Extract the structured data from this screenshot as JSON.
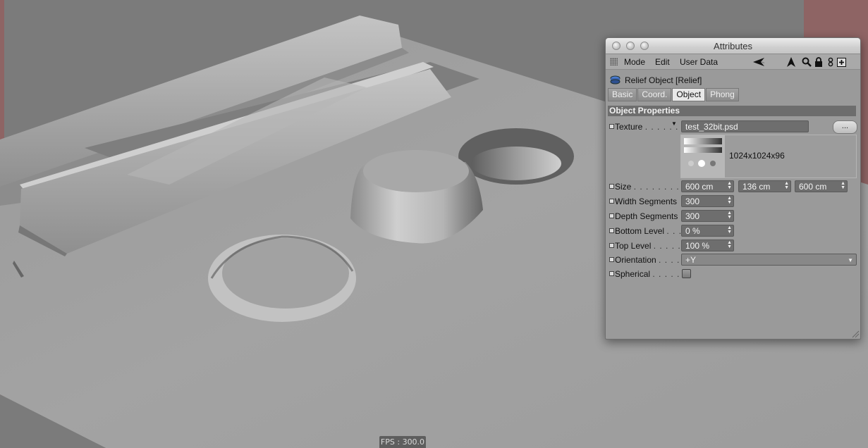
{
  "viewport": {
    "fps": "FPS : 300.0"
  },
  "window": {
    "title": "Attributes",
    "menu": [
      "Mode",
      "Edit",
      "User Data"
    ],
    "toolbar_icons": [
      "back-arrow-icon",
      "cursor-arrow-icon",
      "search-icon",
      "lock-icon",
      "link-icon",
      "new-window-icon"
    ],
    "object_label": "Relief Object [Relief]",
    "tabs": [
      {
        "label": "Basic",
        "active": false
      },
      {
        "label": "Coord.",
        "active": false
      },
      {
        "label": "Object",
        "active": true
      },
      {
        "label": "Phong",
        "active": false
      }
    ],
    "section_title": "Object Properties",
    "texture": {
      "label": "Texture",
      "dots": ". . . . . .",
      "value": "test_32bit.psd",
      "browse_label": "...",
      "info": "1024x1024x96"
    },
    "size": {
      "label": "Size",
      "dots": ". . . . . . . . . .",
      "x": "600 cm",
      "y": "136 cm",
      "z": "600 cm"
    },
    "width_segments": {
      "label": "Width Segments",
      "value": "300"
    },
    "depth_segments": {
      "label": "Depth Segments",
      "value": "300"
    },
    "bottom_level": {
      "label": "Bottom Level",
      "dots": ". . .",
      "value": "0 %"
    },
    "top_level": {
      "label": "Top Level",
      "dots": ". . . . . .",
      "value": "100 %"
    },
    "orientation": {
      "label": "Orientation",
      "dots": ". . . .",
      "value": "+Y"
    },
    "spherical": {
      "label": "Spherical",
      "dots": ". . . . . .",
      "checked": false
    }
  },
  "colors": {
    "viewport_bg": "#7b7b7b",
    "side_tint": "#8e6464",
    "field_bg": "#6e6e6e",
    "section_bg": "#6d6d6d"
  }
}
